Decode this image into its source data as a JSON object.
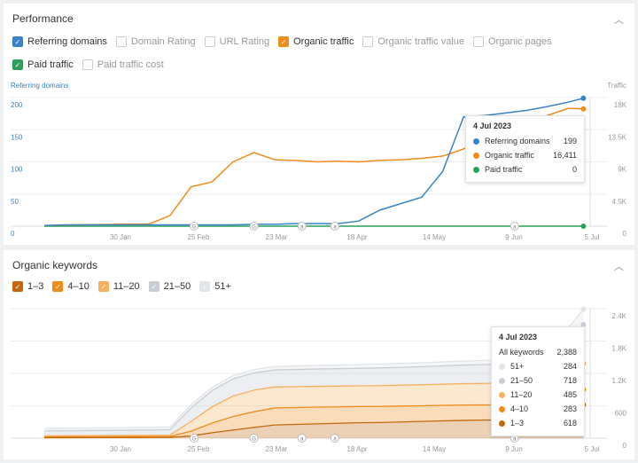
{
  "performance": {
    "title": "Performance",
    "metrics": [
      {
        "label": "Referring domains",
        "checked": true,
        "color": "#3a83c6"
      },
      {
        "label": "Domain Rating",
        "checked": false
      },
      {
        "label": "URL Rating",
        "checked": false
      },
      {
        "label": "Organic traffic",
        "checked": true,
        "color": "#f08c1a"
      },
      {
        "label": "Organic traffic value",
        "checked": false
      },
      {
        "label": "Organic pages",
        "checked": false
      },
      {
        "label": "Paid traffic",
        "checked": true,
        "color": "#2ca05a"
      },
      {
        "label": "Paid traffic cost",
        "checked": false
      }
    ],
    "tooltip": {
      "date": "4 Jul 2023",
      "rows": [
        {
          "label": "Referring domains",
          "value": "199",
          "color": "#3a83c6"
        },
        {
          "label": "Organic traffic",
          "value": "16,411",
          "color": "#f08c1a"
        },
        {
          "label": "Paid traffic",
          "value": "0",
          "color": "#2ca05a"
        }
      ]
    }
  },
  "keywords": {
    "title": "Organic keywords",
    "tooltip": {
      "date": "4 Jul 2023",
      "all_label": "All keywords",
      "all_value": "2,388",
      "rows": [
        {
          "label": "51+",
          "value": "284",
          "color": "#e1e4e9"
        },
        {
          "label": "21–50",
          "value": "718",
          "color": "#c9ced6"
        },
        {
          "label": "11–20",
          "value": "485",
          "color": "#f6b060"
        },
        {
          "label": "4–10",
          "value": "283",
          "color": "#f08c1a"
        },
        {
          "label": "1–3",
          "value": "618",
          "color": "#c5670c"
        }
      ]
    }
  },
  "chart_data": [
    {
      "type": "line",
      "left_axis_label": "Referring domains",
      "right_axis_label": "Traffic",
      "x_ticks": [
        "30 Jan",
        "25 Feb",
        "23 Mar",
        "18 Apr",
        "14 May",
        "9 Jun",
        "5 Jul"
      ],
      "left_ticks": [
        "0",
        "50",
        "100",
        "150",
        "200"
      ],
      "right_ticks": [
        "0",
        "4.5K",
        "9K",
        "13.5K",
        "18K"
      ],
      "left_ylim": [
        0,
        200
      ],
      "right_ylim": [
        0,
        18000
      ],
      "grid": true,
      "annotations": [
        {
          "date": "2023-02-24",
          "label": "G"
        },
        {
          "date": "2023-03-16",
          "label": "G"
        },
        {
          "date": "2023-04-01",
          "label": "a"
        },
        {
          "date": "2023-04-12",
          "label": "a"
        },
        {
          "date": "2023-06-11",
          "label": "a"
        }
      ],
      "x": [
        "2023-01-05",
        "2023-01-12",
        "2023-01-19",
        "2023-01-26",
        "2023-02-02",
        "2023-02-09",
        "2023-02-16",
        "2023-02-23",
        "2023-03-02",
        "2023-03-09",
        "2023-03-16",
        "2023-03-23",
        "2023-03-30",
        "2023-04-06",
        "2023-04-13",
        "2023-04-20",
        "2023-04-27",
        "2023-05-04",
        "2023-05-11",
        "2023-05-18",
        "2023-05-25",
        "2023-06-01",
        "2023-06-08",
        "2023-06-15",
        "2023-06-22",
        "2023-06-29",
        "2023-07-04"
      ],
      "series": [
        {
          "name": "Referring domains",
          "axis": "left",
          "color": "#3a83c6",
          "values": [
            1,
            2,
            2,
            2,
            2,
            2,
            2,
            2,
            2,
            2,
            3,
            3,
            4,
            4,
            4,
            8,
            25,
            35,
            45,
            85,
            170,
            172,
            176,
            180,
            186,
            193,
            199
          ]
        },
        {
          "name": "Organic traffic",
          "axis": "right",
          "color": "#f08c1a",
          "values": [
            100,
            150,
            200,
            250,
            300,
            300,
            1500,
            5500,
            6200,
            9000,
            10300,
            9300,
            9200,
            9000,
            9100,
            9000,
            9200,
            9300,
            9500,
            9800,
            10800,
            12500,
            13500,
            14500,
            15500,
            16500,
            16411
          ]
        },
        {
          "name": "Paid traffic",
          "axis": "right",
          "color": "#2ca05a",
          "values": [
            0,
            0,
            0,
            0,
            0,
            0,
            0,
            0,
            0,
            0,
            0,
            0,
            0,
            0,
            0,
            0,
            0,
            0,
            0,
            0,
            0,
            0,
            0,
            0,
            0,
            0,
            0
          ]
        }
      ]
    },
    {
      "type": "area",
      "stacked": true,
      "x_ticks": [
        "30 Jan",
        "25 Feb",
        "23 Mar",
        "18 Apr",
        "14 May",
        "9 Jun",
        "5 Jul"
      ],
      "right_ticks": [
        "0",
        "600",
        "1.2K",
        "1.8K",
        "2.4K"
      ],
      "ylim": [
        0,
        2400
      ],
      "grid": true,
      "annotations": [
        {
          "date": "2023-02-24",
          "label": "G"
        },
        {
          "date": "2023-03-16",
          "label": "G"
        },
        {
          "date": "2023-04-01",
          "label": "a"
        },
        {
          "date": "2023-04-12",
          "label": "a"
        },
        {
          "date": "2023-06-11",
          "label": "a"
        }
      ],
      "x": [
        "2023-01-05",
        "2023-01-12",
        "2023-01-19",
        "2023-01-26",
        "2023-02-02",
        "2023-02-09",
        "2023-02-16",
        "2023-02-23",
        "2023-03-02",
        "2023-03-09",
        "2023-03-16",
        "2023-03-23",
        "2023-03-30",
        "2023-04-06",
        "2023-04-13",
        "2023-04-20",
        "2023-04-27",
        "2023-05-04",
        "2023-05-11",
        "2023-05-18",
        "2023-05-25",
        "2023-06-01",
        "2023-06-08",
        "2023-06-15",
        "2023-06-22",
        "2023-06-29",
        "2023-07-04"
      ],
      "series": [
        {
          "name": "1–3",
          "color": "#c5670c",
          "values": [
            8,
            9,
            10,
            10,
            11,
            12,
            14,
            40,
            100,
            150,
            200,
            245,
            255,
            265,
            275,
            285,
            290,
            300,
            310,
            320,
            330,
            335,
            340,
            345,
            360,
            450,
            618
          ]
        },
        {
          "name": "4–10",
          "color": "#f08c1a",
          "values": [
            15,
            15,
            16,
            16,
            17,
            17,
            18,
            90,
            180,
            250,
            290,
            315,
            312,
            310,
            305,
            300,
            298,
            295,
            290,
            288,
            285,
            282,
            280,
            280,
            280,
            280,
            283
          ]
        },
        {
          "name": "11–20",
          "color": "#f6b060",
          "values": [
            20,
            20,
            21,
            22,
            22,
            23,
            24,
            180,
            300,
            380,
            400,
            390,
            388,
            386,
            385,
            385,
            386,
            388,
            390,
            392,
            395,
            398,
            400,
            405,
            420,
            470,
            485
          ]
        },
        {
          "name": "21–50",
          "color": "#c9ced6",
          "values": [
            90,
            92,
            94,
            96,
            98,
            100,
            102,
            250,
            300,
            320,
            320,
            315,
            318,
            320,
            322,
            325,
            328,
            330,
            335,
            340,
            345,
            350,
            355,
            360,
            420,
            600,
            718
          ]
        },
        {
          "name": "51+",
          "color": "#e1e4e9",
          "values": [
            45,
            46,
            47,
            48,
            49,
            50,
            50,
            60,
            60,
            60,
            60,
            65,
            66,
            67,
            68,
            69,
            70,
            71,
            72,
            73,
            74,
            75,
            76,
            80,
            120,
            250,
            284
          ]
        }
      ]
    }
  ]
}
